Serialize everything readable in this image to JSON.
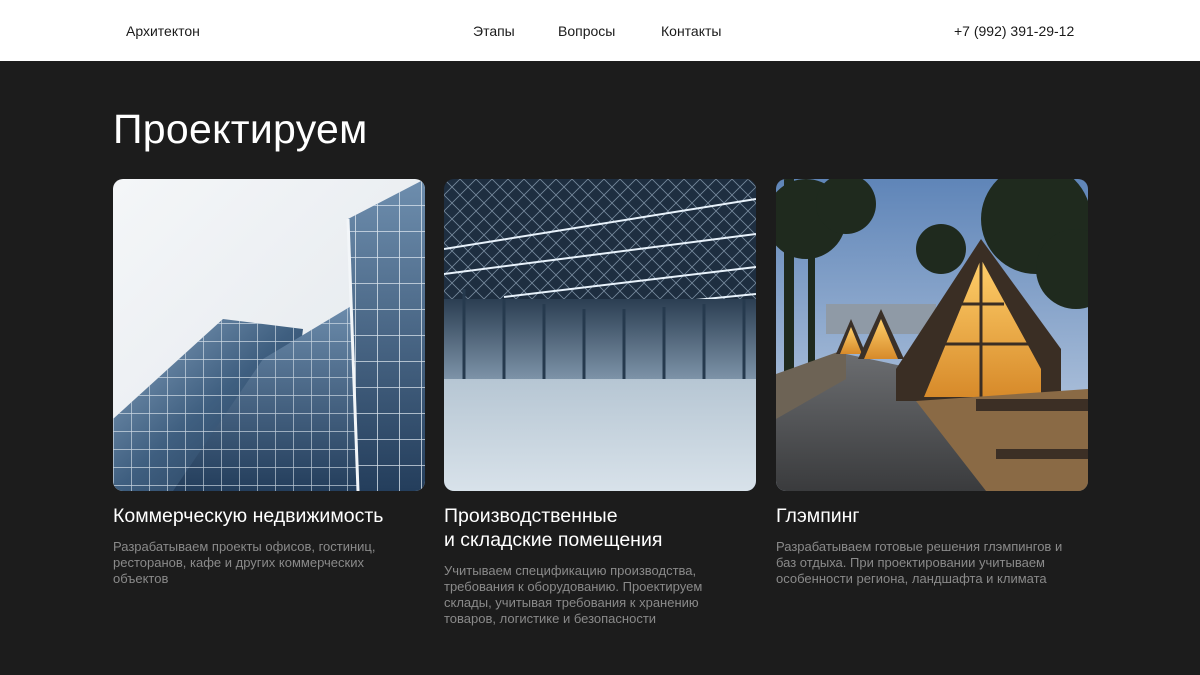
{
  "header": {
    "logo": "Архитектон",
    "nav": [
      "Этапы",
      "Вопросы",
      "Контакты"
    ],
    "phone": "+7 (992) 391-29-12"
  },
  "main": {
    "title": "Проектируем",
    "cards": [
      {
        "image": "glass-office-building-photo",
        "title_lines": [
          "Коммерческую недвижимость"
        ],
        "desc_lines": [
          "Разрабатываем проекты офисов, гостиниц,",
          "ресторанов, кафе и других коммерческих",
          "объектов"
        ]
      },
      {
        "image": "empty-warehouse-interior-photo",
        "title_lines": [
          "Производственные",
          "и складские помещения"
        ],
        "desc_lines": [
          "Учитываем спецификацию производства,",
          "требования к оборудованию. Проектируем",
          "склады, учитывая требования к хранению",
          "товаров, логистике и безопасности"
        ]
      },
      {
        "image": "glamping-a-frame-cabins-photo",
        "title_lines": [
          "Глэмпинг"
        ],
        "desc_lines": [
          "Разрабатываем готовые решения глэмпингов и",
          "баз отдыха. При проектировании учитываем",
          "особенности региона, ландшафта и климата"
        ]
      }
    ]
  },
  "colors": {
    "background": "#1c1c1c",
    "header_bg": "#ffffff",
    "title_text": "#ffffff",
    "desc_text": "#8a8a8a"
  }
}
